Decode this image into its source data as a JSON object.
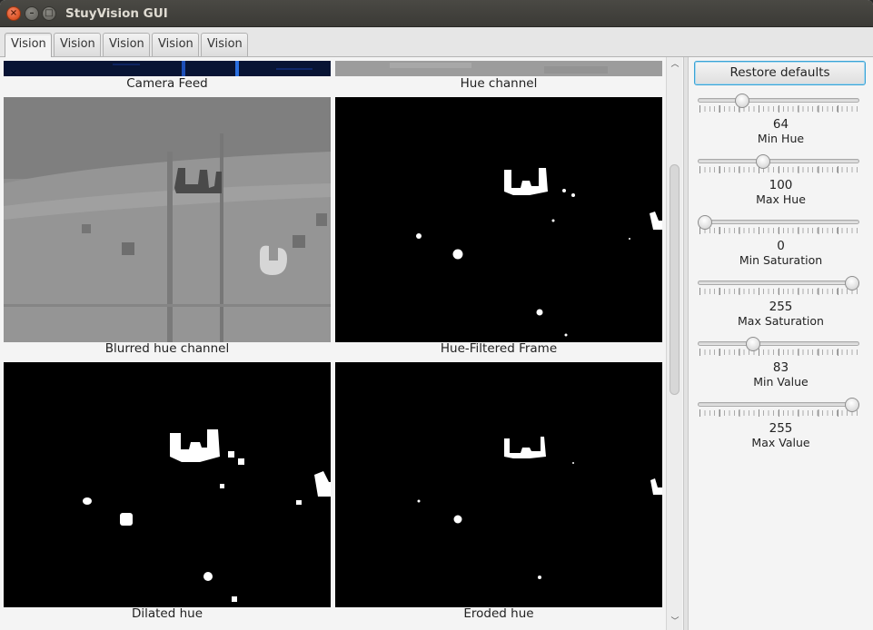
{
  "window": {
    "title": "StuyVision GUI"
  },
  "tabs": [
    {
      "label": "Vision",
      "active": true
    },
    {
      "label": "Vision",
      "active": false
    },
    {
      "label": "Vision",
      "active": false
    },
    {
      "label": "Vision",
      "active": false
    },
    {
      "label": "Vision",
      "active": false
    }
  ],
  "panels": {
    "camera_feed": "Camera Feed",
    "hue_channel": "Hue channel",
    "blurred_hue": "Blurred hue channel",
    "hue_filtered": "Hue-Filtered Frame",
    "dilated_hue": "Dilated hue",
    "eroded_hue": "Eroded hue"
  },
  "controls": {
    "restore_label": "Restore defaults",
    "slider_range": [
      0,
      255
    ],
    "sliders": [
      {
        "label": "Min Hue",
        "value": 64
      },
      {
        "label": "Max Hue",
        "value": 100
      },
      {
        "label": "Min Saturation",
        "value": 0
      },
      {
        "label": "Max Saturation",
        "value": 255
      },
      {
        "label": "Min Value",
        "value": 83
      },
      {
        "label": "Max Value",
        "value": 255
      }
    ]
  },
  "colors": {
    "accent": "#39a3d6",
    "titlebar": "#3c3b37",
    "close_button": "#e05a2c"
  }
}
